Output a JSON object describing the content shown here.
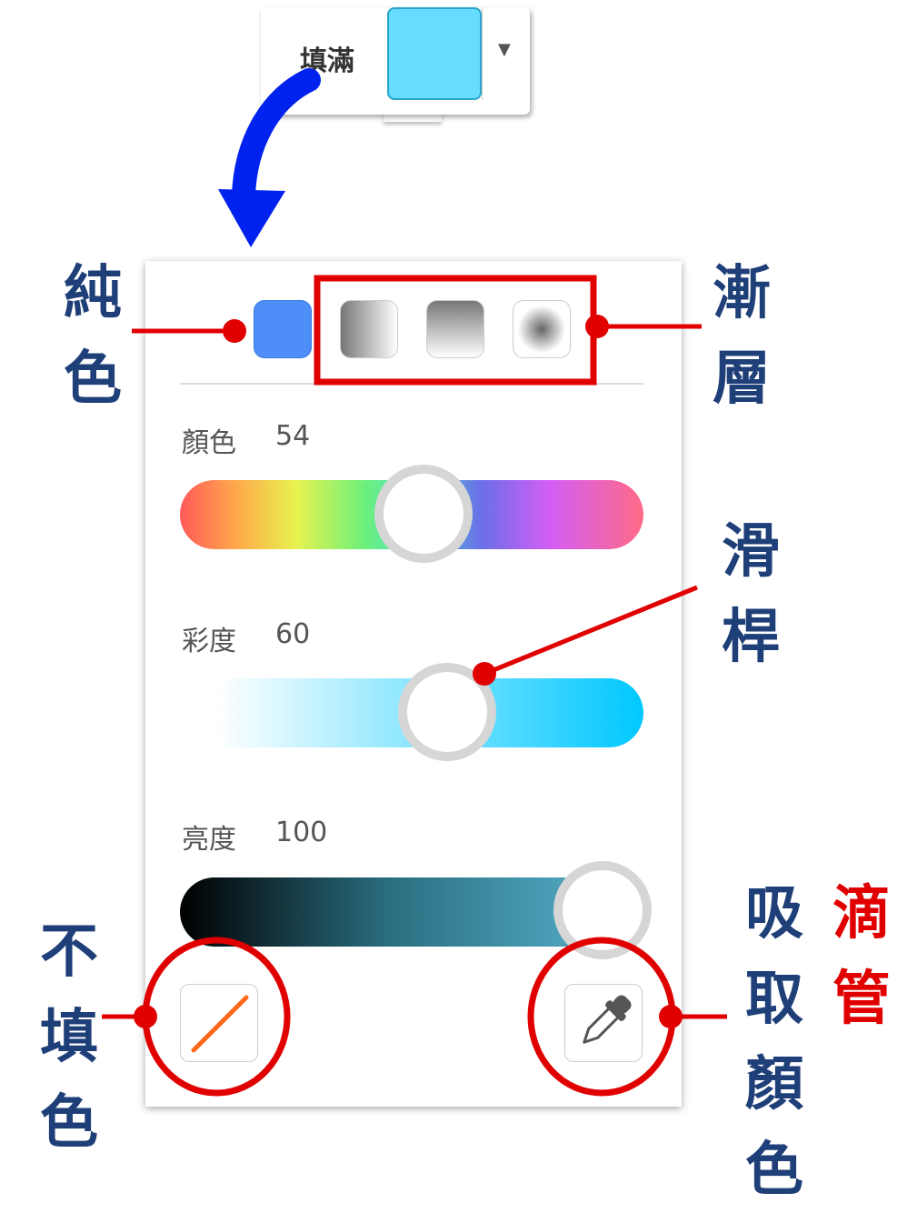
{
  "fill_selector": {
    "label": "填滿",
    "swatch_color": "#67dcff",
    "dropdown_icon": "caret-down-icon"
  },
  "popover": {
    "fill_types": [
      {
        "name": "solid",
        "color": "#4d8ef8"
      },
      {
        "name": "gradient-horizontal"
      },
      {
        "name": "gradient-vertical"
      },
      {
        "name": "gradient-radial"
      }
    ],
    "sliders": [
      {
        "label": "顏色",
        "value": "54"
      },
      {
        "label": "彩度",
        "value": "60"
      },
      {
        "label": "亮度",
        "value": "100"
      }
    ],
    "no_fill_icon": "no-fill-slash-icon",
    "eyedropper_icon": "eyedropper-icon"
  },
  "annotations": {
    "solid": "純色",
    "gradient": "漸層",
    "slider": "滑桿",
    "no_fill": "不填色",
    "pick_color": "吸取顏色",
    "eyedropper": "滴管",
    "arrow_color": "#0022ee",
    "marker_color": "#e00000"
  }
}
